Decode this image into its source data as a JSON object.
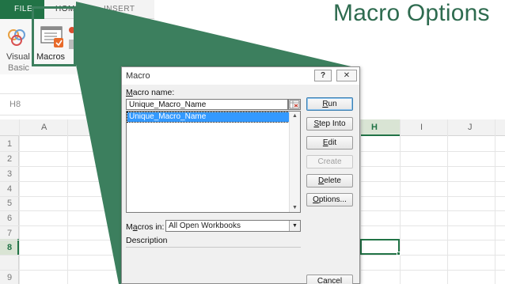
{
  "excel": {
    "tabs": {
      "file": "FILE",
      "home": "HOME",
      "insert": "INSERT"
    },
    "ribbon": {
      "visual_basic_1": "Visual",
      "visual_basic_2": "Basic",
      "macros": "Macros"
    },
    "name_box": "H8",
    "columns": [
      "A",
      "H",
      "I",
      "J"
    ],
    "rows": [
      "1",
      "2",
      "3",
      "4",
      "5",
      "6",
      "7",
      "8",
      "9"
    ],
    "accent_color": "#217346"
  },
  "overlay": {
    "title": "Macro Options",
    "callout_color": "#3c7f5e"
  },
  "dialog": {
    "title": "Macro",
    "help_label": "?",
    "close_label": "✕",
    "macro_name_label_u": "M",
    "macro_name_label_rest": "acro name:",
    "macro_name_value": "Unique_Macro_Name",
    "list_items": [
      "Unique_Macro_Name"
    ],
    "buttons": {
      "run_u": "R",
      "run_rest": "un",
      "step_into_u": "S",
      "step_into_rest": "tep Into",
      "edit_u": "E",
      "edit_rest": "dit",
      "create": "Create",
      "delete_u": "D",
      "delete_rest": "elete",
      "options_u": "O",
      "options_rest": "ptions...",
      "cancel": "Cancel"
    },
    "macros_in_label_pre": "M",
    "macros_in_label_u": "a",
    "macros_in_label_rest": "cros in:",
    "macros_in_value": "All Open Workbooks",
    "description_label": "Description"
  }
}
